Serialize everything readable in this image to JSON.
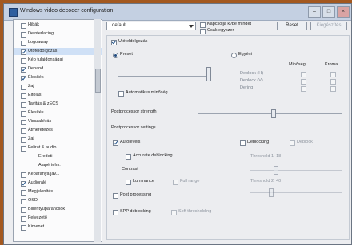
{
  "window": {
    "title": "Windows video decoder configuration",
    "minimize": "–",
    "maximize": "□",
    "close": "×"
  },
  "sidebar": {
    "items": [
      {
        "label": "Hibák",
        "checked": false
      },
      {
        "label": "Deinterlacing",
        "checked": false
      },
      {
        "label": "Logoaway",
        "checked": false
      },
      {
        "label": "Utófeldolgozás",
        "checked": true,
        "selected": true
      },
      {
        "label": "Kép tulajdonságai",
        "checked": false
      },
      {
        "label": "Deband",
        "checked": true
      },
      {
        "label": "Élesítés",
        "checked": true
      },
      {
        "label": "Zaj",
        "checked": false
      },
      {
        "label": "Eltolás",
        "checked": false
      },
      {
        "label": "Tavitás & zÉCS",
        "checked": false
      },
      {
        "label": "Élesítés",
        "checked": false
      },
      {
        "label": "Visszahívás",
        "checked": false
      },
      {
        "label": "Átméretezés",
        "checked": false
      },
      {
        "label": "Zaj",
        "checked": false
      },
      {
        "label": "Felirat & audio",
        "checked": false
      },
      {
        "label": "Eredeti",
        "checked": false,
        "sub": true
      },
      {
        "label": "Alapértelm.",
        "checked": false,
        "sub": true
      },
      {
        "label": "Képaránya jav...",
        "checked": false
      },
      {
        "label": "Audiorálé",
        "checked": true
      },
      {
        "label": "Megjelenítés",
        "checked": false
      },
      {
        "label": "OSD",
        "checked": false
      },
      {
        "label": "Billentyűparancsok",
        "checked": false
      },
      {
        "label": "Felvezető",
        "checked": false
      },
      {
        "label": "Kimenet",
        "checked": false
      }
    ]
  },
  "top": {
    "preset": "default",
    "enable_filter_label": "Kapcsolja ki/be mindet",
    "only_if_label": "Csak egyszer",
    "reset_label": "Reset",
    "extra_label": "Kiegészítés"
  },
  "panel": {
    "enable_label": "Utófeldolgozás",
    "preset_radio": "Preset",
    "custom_radio": "Egyéni",
    "col1": "Minőségi",
    "col2": "Kroma",
    "rows": [
      "Deblock (H)",
      "Deblock (V)",
      "Dering"
    ],
    "auto_quality_label": "Automatikus minőség",
    "strength_label": "Postprocessor strength",
    "params_label": "Postprocessor settings",
    "autolevels_label": "Autolevels",
    "accurate_label": "Accurate deblocking",
    "contrast_label": "Contrast",
    "luminance_label": "Luminance",
    "fullrange_label": "Full range",
    "deblock_label": "Deblocking",
    "deblock_sub_label": "Deblock",
    "threshold_1": "Threshold 1: 18",
    "threshold_2": "Threshold 2: 40",
    "pp_label": "Post processing",
    "spp_label": "SPP deblocking",
    "spp_sub": "Soft thresholding"
  }
}
